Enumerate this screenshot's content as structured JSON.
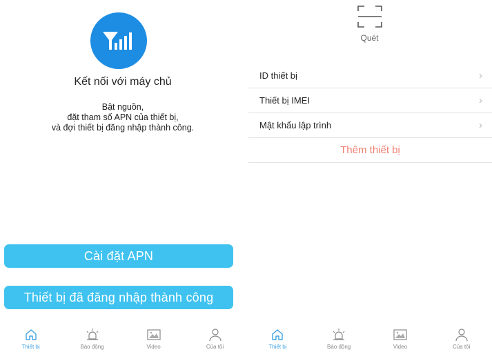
{
  "left_screen": {
    "title": "Kết nối với máy chủ",
    "instructions": [
      "Bật nguồn,",
      "đặt tham số APN của thiết bị,",
      "và đợi thiết bị đăng nhập thành công."
    ],
    "apn_button": "Cài đặt APN",
    "logged_in_button": "Thiết bị đã đăng nhập thành công",
    "icon": "signal-tower-icon"
  },
  "right_screen": {
    "scan_label": "Quét",
    "fields": [
      {
        "label": "ID thiết bị"
      },
      {
        "label": "Thiết bị IMEI"
      },
      {
        "label": "Mật khẩu lập trình"
      }
    ],
    "add_button": "Thêm thiết bị"
  },
  "tabbar": {
    "tabs": [
      {
        "label": "Thiết bị",
        "icon": "home-icon",
        "active": true
      },
      {
        "label": "Báo động",
        "icon": "alarm-icon",
        "active": false
      },
      {
        "label": "Video",
        "icon": "image-icon",
        "active": false
      },
      {
        "label": "Của tôi",
        "icon": "user-icon",
        "active": false
      }
    ]
  },
  "colors": {
    "primary_blue": "#1d8de3",
    "button_blue": "#3fc2f0",
    "add_red": "#ef7f72",
    "tab_active": "#3fa2e0"
  }
}
